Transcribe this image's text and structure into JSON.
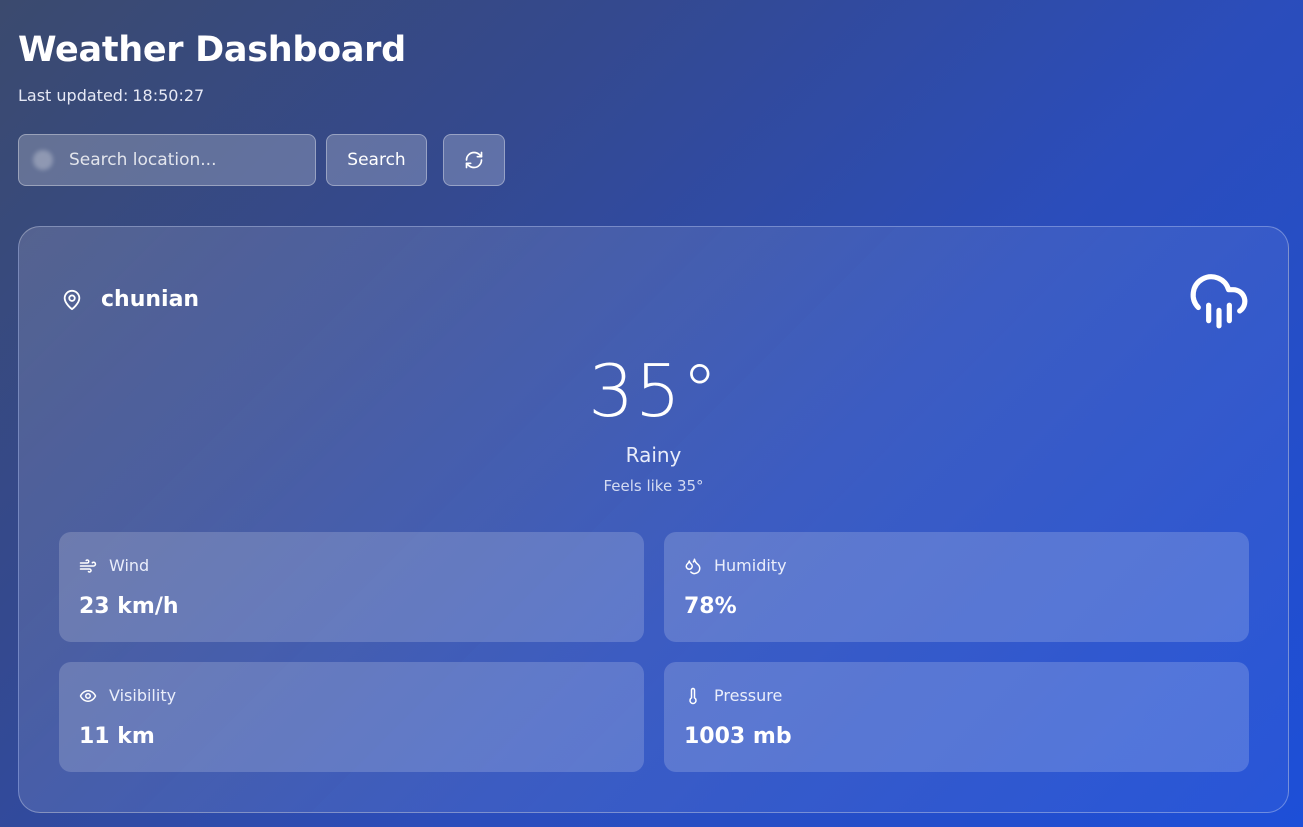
{
  "header": {
    "title": "Weather Dashboard",
    "updated_label": "Last updated:",
    "updated_time": "18:50:27"
  },
  "search": {
    "placeholder": "Search location...",
    "button_label": "Search",
    "refresh_icon": "refresh-icon"
  },
  "weather": {
    "location": "chunian",
    "location_icon": "map-pin-icon",
    "condition_icon": "cloud-rain-icon",
    "temperature": "35°",
    "condition": "Rainy",
    "feels_like": "Feels like 35°"
  },
  "stats": {
    "wind": {
      "label": "Wind",
      "value": "23 km/h",
      "icon": "wind-icon"
    },
    "humidity": {
      "label": "Humidity",
      "value": "78%",
      "icon": "droplets-icon"
    },
    "visibility": {
      "label": "Visibility",
      "value": "11 km",
      "icon": "eye-icon"
    },
    "pressure": {
      "label": "Pressure",
      "value": "1003 mb",
      "icon": "thermometer-icon"
    }
  },
  "colors": {
    "background_start": "#3b4a6e",
    "background_end": "#1d4fd8",
    "text": "#ffffff"
  }
}
